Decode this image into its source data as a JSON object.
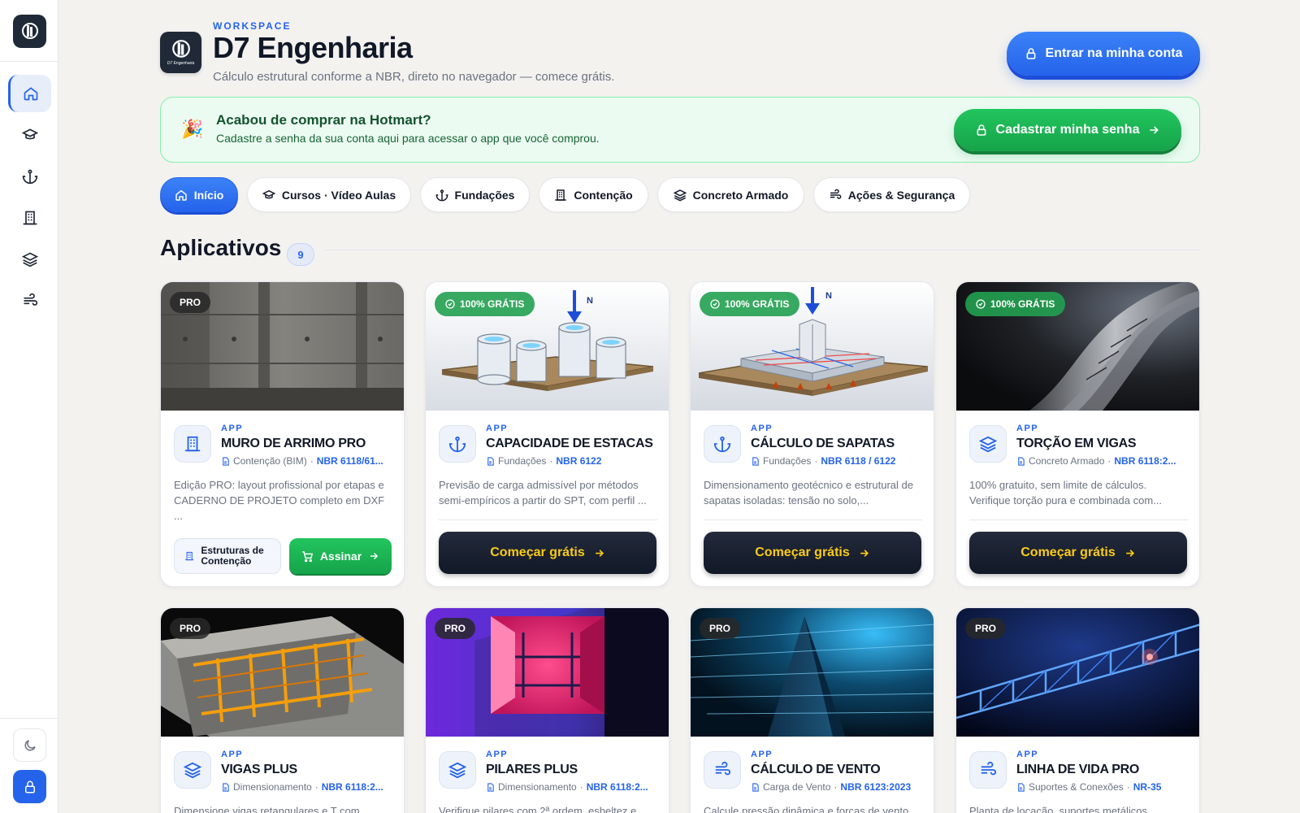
{
  "workspace": {
    "eyebrow": "WORKSPACE",
    "title": "D7 Engenharia",
    "subtitle": "Cálculo estrutural conforme a NBR, direto no navegador — comece grátis.",
    "logo_text": "D7 Engenharia",
    "login_label": "Entrar na minha conta"
  },
  "banner": {
    "icon": "party-icon",
    "title": "Acabou de comprar na Hotmart?",
    "text": "Cadastre a senha da sua conta aqui para acessar o app que você comprou.",
    "button_label": "Cadastrar minha senha"
  },
  "sidebar": {
    "items": [
      {
        "icon": "home-icon"
      },
      {
        "icon": "graduation-cap-icon"
      },
      {
        "icon": "anchor-icon"
      },
      {
        "icon": "building-icon"
      },
      {
        "icon": "layers-icon"
      },
      {
        "icon": "wind-icon"
      }
    ]
  },
  "tabs": [
    {
      "label": "Início",
      "icon": "home-icon"
    },
    {
      "label": "Cursos · Vídeo Aulas",
      "icon": "graduation-cap-icon"
    },
    {
      "label": "Fundações",
      "icon": "anchor-icon"
    },
    {
      "label": "Contenção",
      "icon": "building-icon"
    },
    {
      "label": "Concreto Armado",
      "icon": "layers-icon"
    },
    {
      "label": "Ações & Segurança",
      "icon": "wind-icon"
    }
  ],
  "section": {
    "title": "Aplicativos",
    "count": "9"
  },
  "cards": [
    {
      "badge": "PRO",
      "tag": "APP",
      "name": "MURO DE ARRIMO PRO",
      "category": "Contenção (BIM)",
      "norm": "NBR 6118/61...",
      "desc": "Edição PRO: layout profissional por etapas e CADERNO DE PROJETO completo em DXF ...",
      "cat_button": "Estruturas de Contenção",
      "buy_label": "Assinar"
    },
    {
      "badge": "100% GRÁTIS",
      "tag": "APP",
      "name": "CAPACIDADE DE ESTACAS",
      "category": "Fundações",
      "norm": "NBR 6122",
      "desc": "Previsão de carga admissível por métodos semi-empíricos a partir do SPT, com perfil ...",
      "cta": "Começar grátis",
      "load_label": "N"
    },
    {
      "badge": "100% GRÁTIS",
      "tag": "APP",
      "name": "CÁLCULO DE SAPATAS",
      "category": "Fundações",
      "norm": "NBR 6118 / 6122",
      "desc": "Dimensionamento geotécnico e estrutural de sapatas isoladas: tensão no solo,...",
      "cta": "Começar grátis",
      "load_label": "N"
    },
    {
      "badge": "100% GRÁTIS",
      "tag": "APP",
      "name": "TORÇÃO EM VIGAS",
      "category": "Concreto Armado",
      "norm": "NBR 6118:2...",
      "desc": "100% gratuito, sem limite de cálculos. Verifique torção pura e combinada com...",
      "cta": "Começar grátis"
    },
    {
      "badge": "PRO",
      "tag": "APP",
      "name": "VIGAS PLUS",
      "category": "Dimensionamento",
      "norm": "NBR 6118:2...",
      "desc": "Dimensione vigas retangulares e T com"
    },
    {
      "badge": "PRO",
      "tag": "APP",
      "name": "PILARES PLUS",
      "category": "Dimensionamento",
      "norm": "NBR 6118:2...",
      "desc": "Verifique pilares com 2ª ordem, esbeltez e"
    },
    {
      "badge": "PRO",
      "tag": "APP",
      "name": "CÁLCULO DE VENTO",
      "category": "Carga de Vento",
      "norm": "NBR 6123:2023",
      "desc": "Calcule pressão dinâmica e forças de vento"
    },
    {
      "badge": "PRO",
      "tag": "APP",
      "name": "LINHA DE VIDA PRO",
      "category": "Suportes & Conexões",
      "norm": "NR-35",
      "desc": "Planta de locação, suportes metálicos"
    }
  ],
  "colors": {
    "accent": "#2563eb",
    "success": "#16a34a",
    "cta_text": "#facc15",
    "background": "#f3f2ef"
  }
}
